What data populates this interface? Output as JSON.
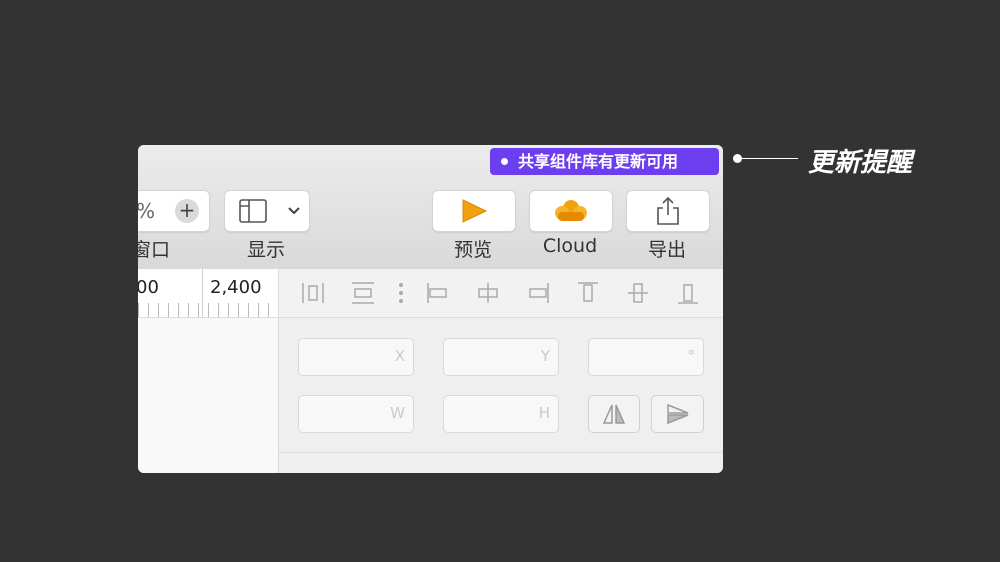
{
  "update_badge": {
    "text": "共享组件库有更新可用",
    "color": "#6d3df0"
  },
  "toolbar": {
    "zoom_percent_fragment": "%",
    "zoom_plus": "+",
    "window_label_fragment": "窗口",
    "display_label": "显示",
    "preview_label": "预览",
    "cloud_label": "Cloud",
    "export_label": "导出"
  },
  "ruler": {
    "left_value": "00",
    "right_value": "2,400"
  },
  "inspector": {
    "x_label": "X",
    "y_label": "Y",
    "rotation_label": "°",
    "w_label": "W",
    "h_label": "H"
  },
  "annotation": {
    "text": "更新提醒"
  },
  "colors": {
    "background": "#333333",
    "accent": "#6d3df0",
    "play": "#f0a10f"
  }
}
